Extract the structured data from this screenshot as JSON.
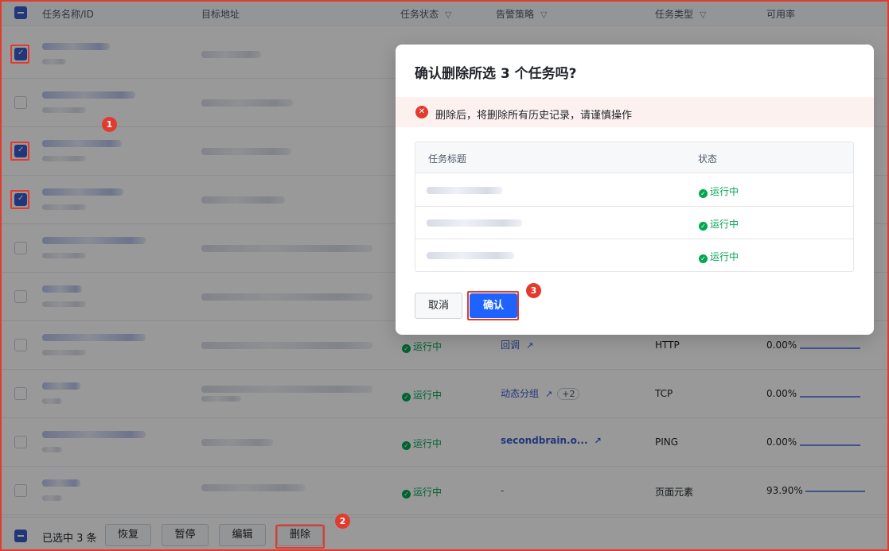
{
  "table": {
    "columns": {
      "name": "任务名称/ID",
      "target": "目标地址",
      "status": "任务状态",
      "policy": "告警策略",
      "type": "任务类型",
      "availability": "可用率"
    },
    "rows": [
      {
        "checked": true,
        "status": "",
        "policy": "",
        "type": "",
        "availability": ""
      },
      {
        "checked": false,
        "status": "",
        "policy": "",
        "type": "",
        "availability": ""
      },
      {
        "checked": true,
        "status": "",
        "policy": "",
        "type": "",
        "availability": ""
      },
      {
        "checked": true,
        "status": "",
        "policy": "",
        "type": "",
        "availability": ""
      },
      {
        "checked": false,
        "status": "",
        "policy": "",
        "type": "",
        "availability": ""
      },
      {
        "checked": false,
        "status": "",
        "policy": "",
        "type": "",
        "availability": ""
      },
      {
        "checked": false,
        "status": "运行中",
        "policy": "回调",
        "policy_extra": "",
        "type": "HTTP",
        "availability": "0.00%"
      },
      {
        "checked": false,
        "status": "运行中",
        "policy": "动态分组",
        "policy_extra": "+2",
        "type": "TCP",
        "availability": "0.00%"
      },
      {
        "checked": false,
        "status": "运行中",
        "policy": "secondbrain.o...",
        "policy_extra": "",
        "type": "PING",
        "availability": "0.00%"
      },
      {
        "checked": false,
        "status": "运行中",
        "policy": "-",
        "policy_extra": "",
        "type": "页面元素",
        "availability": "93.90%"
      }
    ]
  },
  "footer": {
    "selected_text": "已选中 3 条",
    "restore": "恢复",
    "pause": "暂停",
    "edit": "编辑",
    "delete": "删除"
  },
  "dialog": {
    "title": "确认删除所选 3 个任务吗?",
    "warning": "删除后，将删除所有历史记录，请谨慎操作",
    "col_title": "任务标题",
    "col_status": "状态",
    "rows": [
      {
        "status": "运行中"
      },
      {
        "status": "运行中"
      },
      {
        "status": "运行中"
      }
    ],
    "cancel": "取消",
    "confirm": "确认"
  },
  "annotations": [
    "1",
    "2",
    "3"
  ],
  "colors": {
    "primary": "#1e63ff",
    "checkbox": "#3a5ccc",
    "success": "#00a650",
    "danger": "#e23b2e",
    "alert_bg": "#fdf1ef"
  }
}
